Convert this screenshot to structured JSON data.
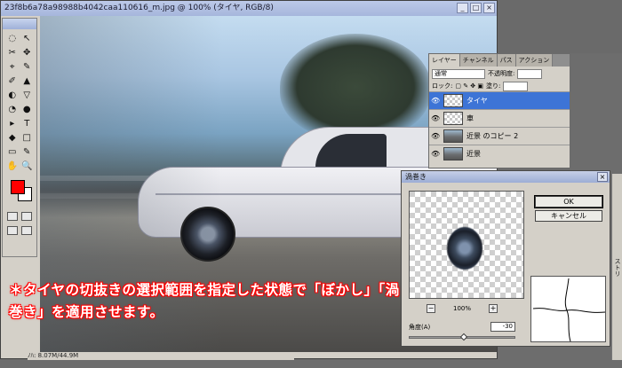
{
  "document": {
    "title": "23f8b6a78a98988b4042caa110616_m.jpg @ 100% (タイヤ, RGB/8)",
    "status": "ﾉﾊ: 8.07M/44.9M",
    "controls": [
      "_",
      "□",
      "×"
    ]
  },
  "toolbox": {
    "tools": [
      "◌",
      "↖",
      "✂",
      "✥",
      "⌖",
      "✎",
      "✐",
      "▲",
      "◐",
      "▽",
      "◔",
      "●",
      "▸",
      "T",
      "◆",
      "□",
      "▭",
      "✎",
      "✋",
      "🔍"
    ],
    "foreground_color": "#ff0000",
    "background_color": "#ffffff"
  },
  "layers": {
    "tabs": [
      "レイヤー",
      "チャンネル",
      "パス",
      "アクション"
    ],
    "blend_mode": "通常",
    "opacity_label": "不透明度:",
    "lock_label": "ロック:",
    "fill_label": "塗り:",
    "items": [
      {
        "name": "タイヤ",
        "selected": true
      },
      {
        "name": "車",
        "selected": false
      },
      {
        "name": "近景 のコピー 2",
        "selected": false
      },
      {
        "name": "近景",
        "selected": false
      }
    ]
  },
  "twirl_dialog": {
    "title": "渦巻き",
    "ok_label": "OK",
    "cancel_label": "キャンセル",
    "zoom": "100%",
    "zoom_minus": "−",
    "zoom_plus": "+",
    "angle_label": "角度(A)",
    "angle_value": "-30"
  },
  "side_panel": {
    "label": "ストリ"
  },
  "caption": {
    "text": "＊タイヤの切抜きの選択範囲を指定した状態で「ぼかし」「渦巻き」を適用させます。"
  },
  "colors": {
    "caption_outline": "#ff0000",
    "selected_layer": "#3d74d6"
  }
}
